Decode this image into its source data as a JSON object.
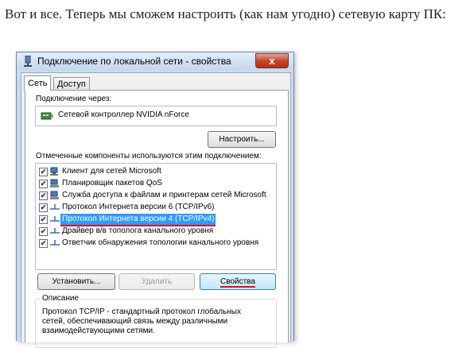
{
  "intro_text": "Вот и все. Теперь мы сможем настроить (как нам угодно) сетевую карту ПК:",
  "window": {
    "title": "Подключение по локальной сети - свойства",
    "close_glyph": "x"
  },
  "tabs": [
    {
      "label": "Сеть",
      "active": true
    },
    {
      "label": "Доступ",
      "active": false
    }
  ],
  "connect_via_label": "Подключение через:",
  "adapter_name": "Сетевой контроллер NVIDIA nForce",
  "configure_button": "Настроить...",
  "components_label": "Отмеченные компоненты используются этим подключением:",
  "components": [
    {
      "label": "Клиент для сетей Microsoft",
      "checked": true,
      "icon": "network-client-icon"
    },
    {
      "label": "Планировщик пакетов QoS",
      "checked": true,
      "icon": "network-service-icon"
    },
    {
      "label": "Служба доступа к файлам и принтерам сетей Microsoft",
      "checked": true,
      "icon": "network-service-icon"
    },
    {
      "label": "Протокол Интернета версии 6 (TCP/IPv6)",
      "checked": true,
      "icon": "protocol-icon"
    },
    {
      "label": "Протокол Интернета версии 4 (TCP/IPv4)",
      "checked": true,
      "icon": "protocol-icon",
      "selected": true
    },
    {
      "label": "Драйвер в/в тополога канального уровня",
      "checked": true,
      "icon": "protocol-icon"
    },
    {
      "label": "Ответчик обнаружения топологии канального уровня",
      "checked": true,
      "icon": "protocol-icon"
    }
  ],
  "install_button": "Установить...",
  "remove_button": "Удалить",
  "properties_button": "Свойства",
  "description": {
    "title": "Описание",
    "text": "Протокол TCP/IP - стандартный протокол глобальных сетей, обеспечивающий связь между различными взаимодействующими сетями."
  },
  "check_glyph": "✔",
  "colors": {
    "selection": "#3399ff",
    "underline": "#d8141b",
    "titlebar": "#c9dcef"
  }
}
